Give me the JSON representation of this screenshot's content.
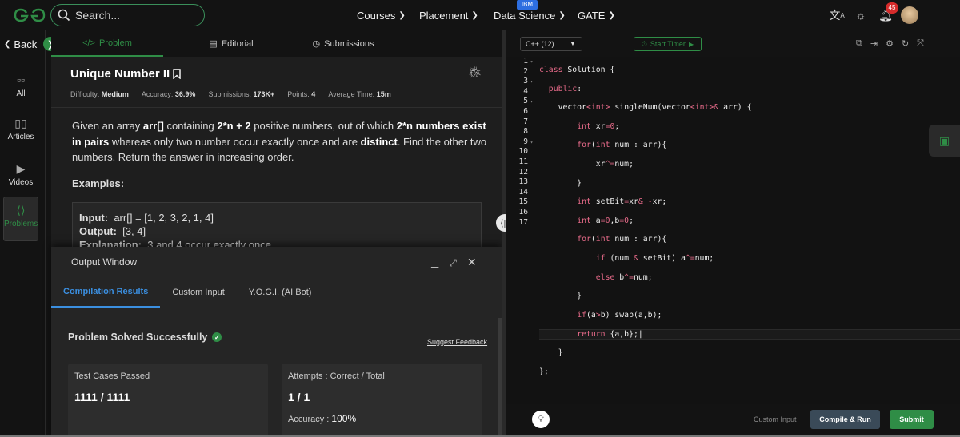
{
  "header": {
    "logo": "GfG",
    "search_placeholder": "Search...",
    "nav": [
      {
        "label": "Courses"
      },
      {
        "label": "Placement"
      },
      {
        "label": "Data Science"
      },
      {
        "label": "GATE"
      }
    ],
    "ibm_badge": "IBM",
    "notification_count": "45",
    "icons": [
      "translate-icon",
      "theme-sun-icon",
      "bell-icon",
      "avatar"
    ]
  },
  "sidebar": {
    "back_label": "Back",
    "items": [
      {
        "label": "All",
        "icon": "grid-icon"
      },
      {
        "label": "Articles",
        "icon": "book-icon"
      },
      {
        "label": "Videos",
        "icon": "play-icon"
      },
      {
        "label": "Problems",
        "icon": "code-icon",
        "active": true
      }
    ]
  },
  "problem_tabs": [
    {
      "label": "Problem",
      "icon": "</>",
      "active": true
    },
    {
      "label": "Editorial",
      "icon": "▤"
    },
    {
      "label": "Submissions",
      "icon": "◷"
    }
  ],
  "problem": {
    "title": "Unique Number II",
    "meta": {
      "difficulty_label": "Difficulty:",
      "difficulty": "Medium",
      "accuracy_label": "Accuracy:",
      "accuracy": "36.9%",
      "submissions_label": "Submissions:",
      "submissions": "173K+",
      "points_label": "Points:",
      "points": "4",
      "avg_time_label": "Average Time:",
      "avg_time": "15m"
    },
    "desc_1": "Given an array ",
    "desc_arr": "arr[]",
    "desc_2": " containing ",
    "desc_2n2": "2*n + 2",
    "desc_3": " positive numbers, out of which ",
    "desc_pairs": "2*n numbers exist in pairs",
    "desc_4": " whereas only two number occur exactly once and are ",
    "desc_distinct": "distinct",
    "desc_5": ". Find the other two numbers. Return the answer in increasing order.",
    "examples_label": "Examples:",
    "example": {
      "input_label": "Input:",
      "input": "arr[] = [1, 2, 3, 2, 1, 4]",
      "output_label": "Output:",
      "output": "[3, 4]",
      "explanation_label": "Explanation:",
      "explanation": "3 and 4 occur exactly once."
    }
  },
  "output_window": {
    "title": "Output Window",
    "tabs": [
      {
        "label": "Compilation Results",
        "active": true
      },
      {
        "label": "Custom Input"
      },
      {
        "label": "Y.O.G.I. (AI Bot)"
      }
    ],
    "solved_message": "Problem Solved Successfully",
    "suggest_feedback": "Suggest Feedback",
    "test_cases_label": "Test Cases Passed",
    "test_cases_value": "1111 / 1111",
    "attempts_label": "Attempts : Correct / Total",
    "attempts_value": "1 / 1",
    "accuracy_label": "Accuracy :",
    "accuracy_value": "100%"
  },
  "editor": {
    "language": "C++ (12)",
    "timer_label": "Start Timer",
    "line_numbers": [
      "1",
      "2",
      "3",
      "4",
      "5",
      "6",
      "7",
      "8",
      "9",
      "10",
      "11",
      "12",
      "13",
      "14",
      "15",
      "16",
      "17"
    ],
    "fold_markers": [
      "▾",
      "",
      "▾",
      "",
      "▾",
      "",
      "",
      "",
      "▾",
      "",
      "",
      "",
      "",
      "",
      "",
      "",
      ""
    ]
  },
  "footer": {
    "custom_input": "Custom Input",
    "compile_run": "Compile & Run",
    "submit": "Submit"
  },
  "colors": {
    "accent_green": "#2f8d46",
    "accent_blue": "#3b8fe0",
    "keyword_pink": "#e86b8a"
  }
}
